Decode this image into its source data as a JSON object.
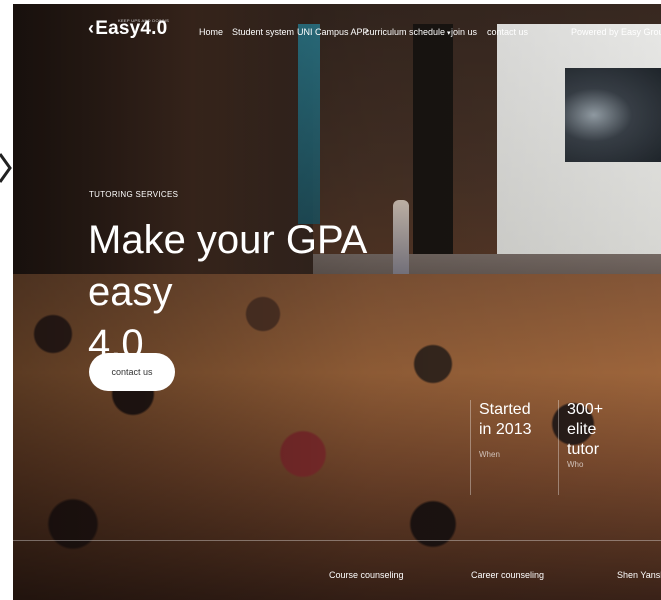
{
  "nav": {
    "logo_text": "Easy4.0",
    "logo_tagline": "KEEP UPS AND DOWNS",
    "items": [
      {
        "label": "Home"
      },
      {
        "label": "Student system"
      },
      {
        "label": "UNI Campus APP"
      },
      {
        "label": "curriculum schedule",
        "has_dropdown": true
      },
      {
        "label": "join us"
      },
      {
        "label": "contact us"
      }
    ],
    "powered_by": "Powered by Easy Group"
  },
  "hero": {
    "kicker": "TUTORING SERVICES",
    "headline_line1": "Make your GPA easy",
    "headline_line2": "4.0",
    "cta_label": "contact us"
  },
  "stats": [
    {
      "line1": "Started",
      "line2": "in 2013",
      "line3": "",
      "sub": "When"
    },
    {
      "line1": "300+",
      "line2": "elite",
      "line3": "tutor",
      "sub": "Who"
    }
  ],
  "bottom_bar": [
    {
      "label": "Course counseling"
    },
    {
      "label": "Career counseling"
    },
    {
      "label": "Shen Yansho"
    }
  ],
  "colors": {
    "text": "#ffffff",
    "cta_bg": "#ffffff",
    "cta_text": "#333333"
  }
}
